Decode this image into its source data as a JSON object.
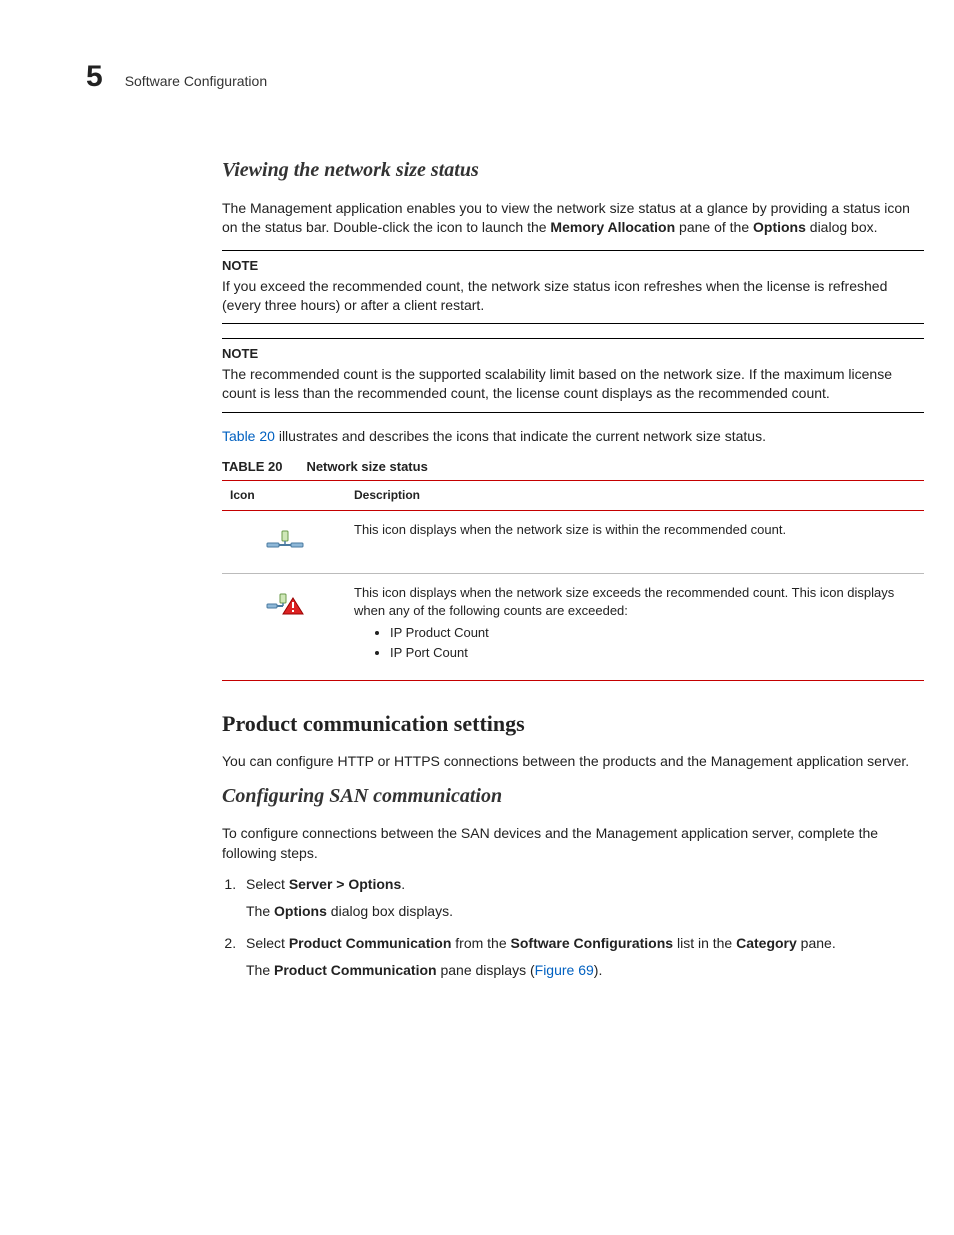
{
  "header": {
    "chapter_number": "5",
    "chapter_title": "Software Configuration"
  },
  "sec1": {
    "title": "Viewing the network size status",
    "intro_a": "The Management application enables you to view the network size status at a glance by providing a status icon on the status bar. Double-click the icon to launch the ",
    "intro_bold1": "Memory Allocation",
    "intro_b": " pane of the ",
    "intro_bold2": "Options",
    "intro_c": " dialog box.",
    "note1_label": "NOTE",
    "note1_text": "If you exceed the recommended count, the network size status icon refreshes when the license is refreshed (every three hours) or after a client restart.",
    "note2_label": "NOTE",
    "note2_text": "The recommended count is the supported scalability limit based on the network size. If the maximum license count is less than the recommended count, the license count displays as the recommended count.",
    "leadin_link": "Table 20",
    "leadin_rest": " illustrates and describes the icons that indicate the current network size status."
  },
  "table": {
    "label": "TABLE 20",
    "caption": "Network size status",
    "col1": "Icon",
    "col2": "Description",
    "row1_desc": "This icon displays when the network size is within the recommended count.",
    "row2_desc": "This icon displays when the network size exceeds the recommended count. This icon displays when any of the following counts are exceeded:",
    "row2_b1": "IP Product Count",
    "row2_b2": "IP Port Count"
  },
  "sec2": {
    "title": "Product communication settings",
    "intro": "You can configure HTTP or HTTPS connections between the products and the Management application server."
  },
  "sec3": {
    "title": "Configuring SAN communication",
    "intro": "To configure connections between the SAN devices and the Management application server, complete the following steps.",
    "step1_a": "Select ",
    "step1_bold": "Server > Options",
    "step1_b": ".",
    "step1_sub_a": "The ",
    "step1_sub_bold": "Options",
    "step1_sub_b": " dialog box displays.",
    "step2_a": "Select ",
    "step2_bold1": "Product Communication",
    "step2_b": " from the ",
    "step2_bold2": "Software Configurations",
    "step2_c": " list in the ",
    "step2_bold3": "Category",
    "step2_d": " pane.",
    "step2_sub_a": "The ",
    "step2_sub_bold": "Product Communication",
    "step2_sub_b": " pane displays (",
    "step2_sub_link": "Figure 69",
    "step2_sub_c": ")."
  }
}
